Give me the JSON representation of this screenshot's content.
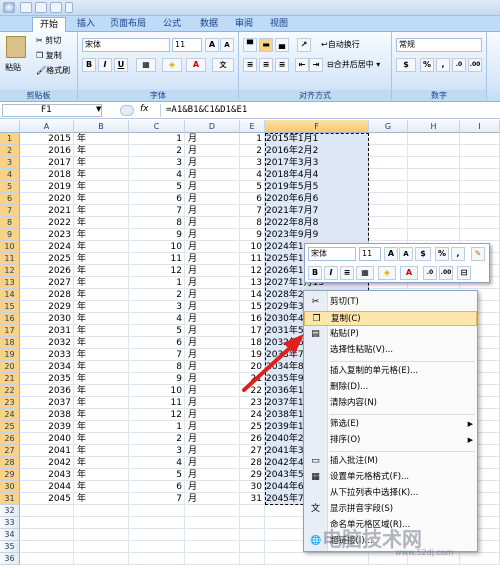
{
  "tabs": [
    "开始",
    "插入",
    "页面布局",
    "公式",
    "数据",
    "审阅",
    "视图"
  ],
  "clipboard": {
    "paste": "粘贴",
    "cut": "剪切",
    "copy": "复制",
    "format_painter": "格式刷",
    "group": "剪贴板"
  },
  "font": {
    "name": "宋体",
    "size": "11",
    "group": "字体",
    "bold": "B",
    "italic": "I",
    "underline": "U"
  },
  "alignment": {
    "wrap": "自动换行",
    "merge": "合并后居中",
    "group": "对齐方式"
  },
  "number": {
    "format": "常规",
    "group": "数字",
    "percent": "%"
  },
  "name_box": "F1",
  "fx": "fx",
  "formula": "=A1&B1&C1&D1&E1",
  "columns": [
    "A",
    "B",
    "C",
    "D",
    "E",
    "F",
    "G",
    "H",
    "I"
  ],
  "rows": [
    {
      "n": "1",
      "a": "2015",
      "b": "年",
      "c": "1",
      "d": "月",
      "e": "1",
      "f": "2015年1月1"
    },
    {
      "n": "2",
      "a": "2016",
      "b": "年",
      "c": "2",
      "d": "月",
      "e": "2",
      "f": "2016年2月2"
    },
    {
      "n": "3",
      "a": "2017",
      "b": "年",
      "c": "3",
      "d": "月",
      "e": "3",
      "f": "2017年3月3"
    },
    {
      "n": "4",
      "a": "2018",
      "b": "年",
      "c": "4",
      "d": "月",
      "e": "4",
      "f": "2018年4月4"
    },
    {
      "n": "5",
      "a": "2019",
      "b": "年",
      "c": "5",
      "d": "月",
      "e": "5",
      "f": "2019年5月5"
    },
    {
      "n": "6",
      "a": "2020",
      "b": "年",
      "c": "6",
      "d": "月",
      "e": "6",
      "f": "2020年6月6"
    },
    {
      "n": "7",
      "a": "2021",
      "b": "年",
      "c": "7",
      "d": "月",
      "e": "7",
      "f": "2021年7月7"
    },
    {
      "n": "8",
      "a": "2022",
      "b": "年",
      "c": "8",
      "d": "月",
      "e": "8",
      "f": "2022年8月8"
    },
    {
      "n": "9",
      "a": "2023",
      "b": "年",
      "c": "9",
      "d": "月",
      "e": "9",
      "f": "2023年9月9"
    },
    {
      "n": "10",
      "a": "2024",
      "b": "年",
      "c": "10",
      "d": "月",
      "e": "10",
      "f": "2024年1"
    },
    {
      "n": "11",
      "a": "2025",
      "b": "年",
      "c": "11",
      "d": "月",
      "e": "11",
      "f": "2025年1"
    },
    {
      "n": "12",
      "a": "2026",
      "b": "年",
      "c": "12",
      "d": "月",
      "e": "12",
      "f": "2026年1"
    },
    {
      "n": "13",
      "a": "2027",
      "b": "年",
      "c": "1",
      "d": "月",
      "e": "13",
      "f": "2027年1月13"
    },
    {
      "n": "14",
      "a": "2028",
      "b": "年",
      "c": "2",
      "d": "月",
      "e": "14",
      "f": "2028年2"
    },
    {
      "n": "15",
      "a": "2029",
      "b": "年",
      "c": "3",
      "d": "月",
      "e": "15",
      "f": "2029年3"
    },
    {
      "n": "16",
      "a": "2030",
      "b": "年",
      "c": "4",
      "d": "月",
      "e": "16",
      "f": "2030年4"
    },
    {
      "n": "17",
      "a": "2031",
      "b": "年",
      "c": "5",
      "d": "月",
      "e": "17",
      "f": "2031年5"
    },
    {
      "n": "18",
      "a": "2032",
      "b": "年",
      "c": "6",
      "d": "月",
      "e": "18",
      "f": "2032年6"
    },
    {
      "n": "19",
      "a": "2033",
      "b": "年",
      "c": "7",
      "d": "月",
      "e": "19",
      "f": "2033年7"
    },
    {
      "n": "20",
      "a": "2034",
      "b": "年",
      "c": "8",
      "d": "月",
      "e": "20",
      "f": "2034年8"
    },
    {
      "n": "21",
      "a": "2035",
      "b": "年",
      "c": "9",
      "d": "月",
      "e": "21",
      "f": "2035年9"
    },
    {
      "n": "22",
      "a": "2036",
      "b": "年",
      "c": "10",
      "d": "月",
      "e": "22",
      "f": "2036年1"
    },
    {
      "n": "23",
      "a": "2037",
      "b": "年",
      "c": "11",
      "d": "月",
      "e": "23",
      "f": "2037年1"
    },
    {
      "n": "24",
      "a": "2038",
      "b": "年",
      "c": "12",
      "d": "月",
      "e": "24",
      "f": "2038年1"
    },
    {
      "n": "25",
      "a": "2039",
      "b": "年",
      "c": "1",
      "d": "月",
      "e": "25",
      "f": "2039年1"
    },
    {
      "n": "26",
      "a": "2040",
      "b": "年",
      "c": "2",
      "d": "月",
      "e": "26",
      "f": "2040年2"
    },
    {
      "n": "27",
      "a": "2041",
      "b": "年",
      "c": "3",
      "d": "月",
      "e": "27",
      "f": "2041年3"
    },
    {
      "n": "28",
      "a": "2042",
      "b": "年",
      "c": "4",
      "d": "月",
      "e": "28",
      "f": "2042年4"
    },
    {
      "n": "29",
      "a": "2043",
      "b": "年",
      "c": "5",
      "d": "月",
      "e": "29",
      "f": "2043年5"
    },
    {
      "n": "30",
      "a": "2044",
      "b": "年",
      "c": "6",
      "d": "月",
      "e": "30",
      "f": "2044年6"
    },
    {
      "n": "31",
      "a": "2045",
      "b": "年",
      "c": "7",
      "d": "月",
      "e": "31",
      "f": "2045年7"
    },
    {
      "n": "32",
      "a": "",
      "b": "",
      "c": "",
      "d": "",
      "e": "",
      "f": ""
    },
    {
      "n": "33",
      "a": "",
      "b": "",
      "c": "",
      "d": "",
      "e": "",
      "f": ""
    },
    {
      "n": "34",
      "a": "",
      "b": "",
      "c": "",
      "d": "",
      "e": "",
      "f": ""
    },
    {
      "n": "35",
      "a": "",
      "b": "",
      "c": "",
      "d": "",
      "e": "",
      "f": ""
    },
    {
      "n": "36",
      "a": "",
      "b": "",
      "c": "",
      "d": "",
      "e": "",
      "f": ""
    }
  ],
  "mini_toolbar": {
    "font": "宋体",
    "size": "11",
    "percent": "%"
  },
  "context_menu": [
    {
      "label": "剪切(T)",
      "icon": "scissors-icon",
      "glyph": "✂"
    },
    {
      "label": "复制(C)",
      "icon": "copy-icon",
      "glyph": "❐",
      "highlight": true
    },
    {
      "label": "粘贴(P)",
      "icon": "paste-icon",
      "glyph": "▤"
    },
    {
      "label": "选择性粘贴(V)..."
    },
    {
      "sep": true
    },
    {
      "label": "插入复制的单元格(E)..."
    },
    {
      "label": "删除(D)..."
    },
    {
      "label": "清除内容(N)"
    },
    {
      "sep": true
    },
    {
      "label": "筛选(E)",
      "submenu": true
    },
    {
      "label": "排序(O)",
      "submenu": true
    },
    {
      "sep": true
    },
    {
      "label": "插入批注(M)",
      "icon": "comment-icon",
      "glyph": "▭"
    },
    {
      "label": "设置单元格格式(F)...",
      "icon": "format-cells-icon",
      "glyph": "▦"
    },
    {
      "label": "从下拉列表中选择(K)..."
    },
    {
      "label": "显示拼音字段(S)",
      "icon": "phonetic-icon",
      "glyph": "文"
    },
    {
      "label": "命名单元格区域(R)..."
    },
    {
      "label": "超链接(I)...",
      "icon": "hyperlink-icon",
      "glyph": "🌐"
    }
  ],
  "watermark": "电脑技术网",
  "watermark_url": "www.52dj.com",
  "colors": {
    "accent": "#15428b",
    "highlight": "#fde6ac",
    "arrow": "#e0201e"
  }
}
